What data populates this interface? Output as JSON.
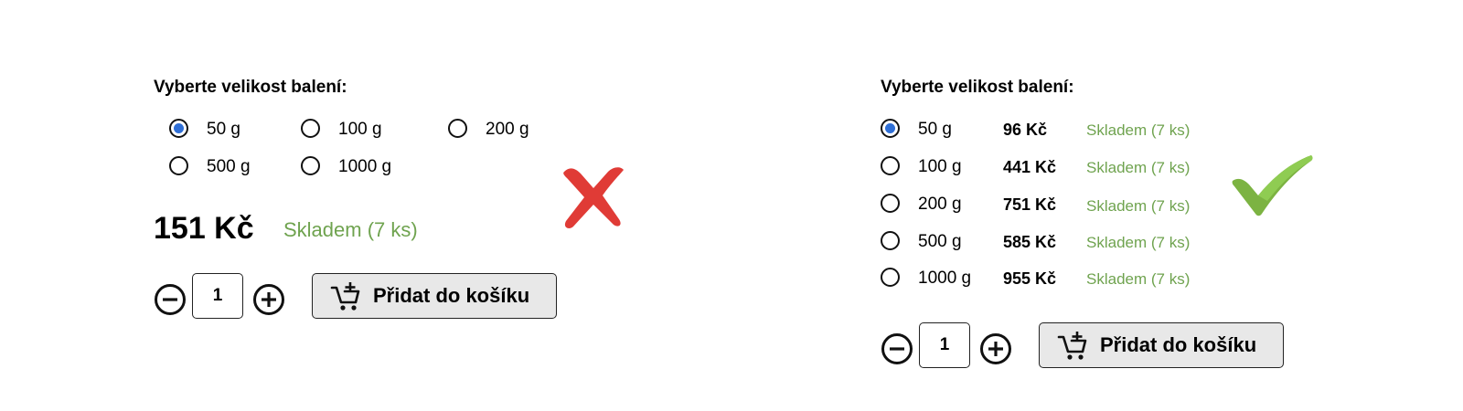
{
  "left_panel": {
    "heading": "Vyberte velikost balení:",
    "options": [
      {
        "label": "50 g",
        "selected": true
      },
      {
        "label": "100 g",
        "selected": false
      },
      {
        "label": "200 g",
        "selected": false
      },
      {
        "label": "500 g",
        "selected": false
      },
      {
        "label": "1000 g",
        "selected": false
      }
    ],
    "price": "151 Kč",
    "stock": "Skladem (7 ks)",
    "quantity": "1",
    "add_to_cart_label": "Přidat do košíku"
  },
  "right_panel": {
    "heading": "Vyberte velikost balení:",
    "options": [
      {
        "label": "50 g",
        "price": "96 Kč",
        "stock": "Skladem (7 ks)",
        "selected": true
      },
      {
        "label": "100 g",
        "price": "441 Kč",
        "stock": "Skladem (7 ks)",
        "selected": false
      },
      {
        "label": "200 g",
        "price": "751 Kč",
        "stock": "Skladem (7 ks)",
        "selected": false
      },
      {
        "label": "500 g",
        "price": "585 Kč",
        "stock": "Skladem (7 ks)",
        "selected": false
      },
      {
        "label": "1000 g",
        "price": "955 Kč",
        "stock": "Skladem (7 ks)",
        "selected": false
      }
    ],
    "quantity": "1",
    "add_to_cart_label": "Přidat do košíku"
  },
  "colors": {
    "stock_green": "#6fa34f",
    "radio_selected": "#2f6fd6",
    "cross_red": "#e03b36",
    "check_green": "#7cb342"
  },
  "icons": {
    "minus": "minus-circle-icon",
    "plus": "plus-circle-icon",
    "cart": "cart-add-icon",
    "bad": "cross-mark-icon",
    "good": "check-mark-icon"
  }
}
